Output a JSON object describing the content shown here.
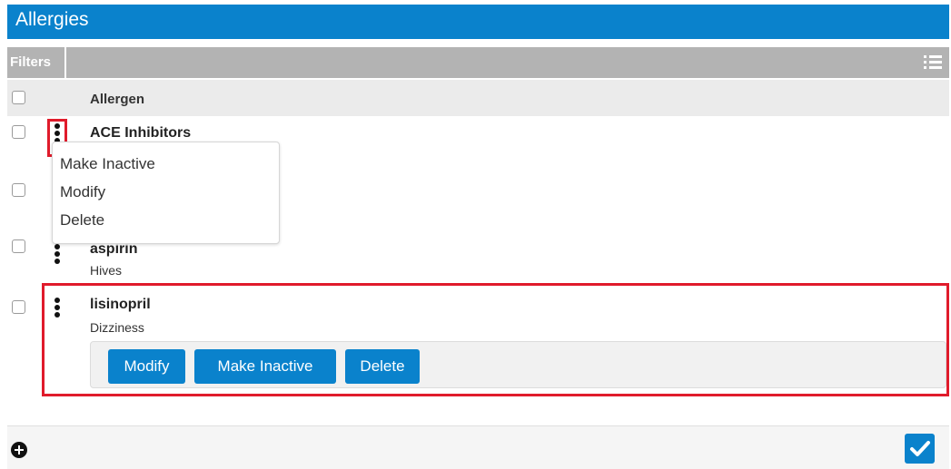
{
  "header": {
    "title": "Allergies"
  },
  "toolbar": {
    "filters_label": "Filters",
    "list_view_icon": "list-icon"
  },
  "table": {
    "column_header": "Allergen",
    "rows": [
      {
        "name": "ACE Inhibitors",
        "reaction": ""
      },
      {
        "name": "",
        "reaction": ""
      },
      {
        "name": "aspirin",
        "reaction": "Hives"
      },
      {
        "name": "lisinopril",
        "reaction": "Dizziness"
      }
    ]
  },
  "context_menu": {
    "items": [
      "Make Inactive",
      "Modify",
      "Delete"
    ]
  },
  "actions": {
    "modify": "Modify",
    "make_inactive": "Make Inactive",
    "delete": "Delete"
  },
  "footer": {
    "add_icon": "plus-circle-icon",
    "confirm_icon": "checkmark-icon"
  },
  "colors": {
    "accent": "#0a82cc",
    "highlight": "#e01b2b",
    "toolbar": "#b3b3b3"
  }
}
